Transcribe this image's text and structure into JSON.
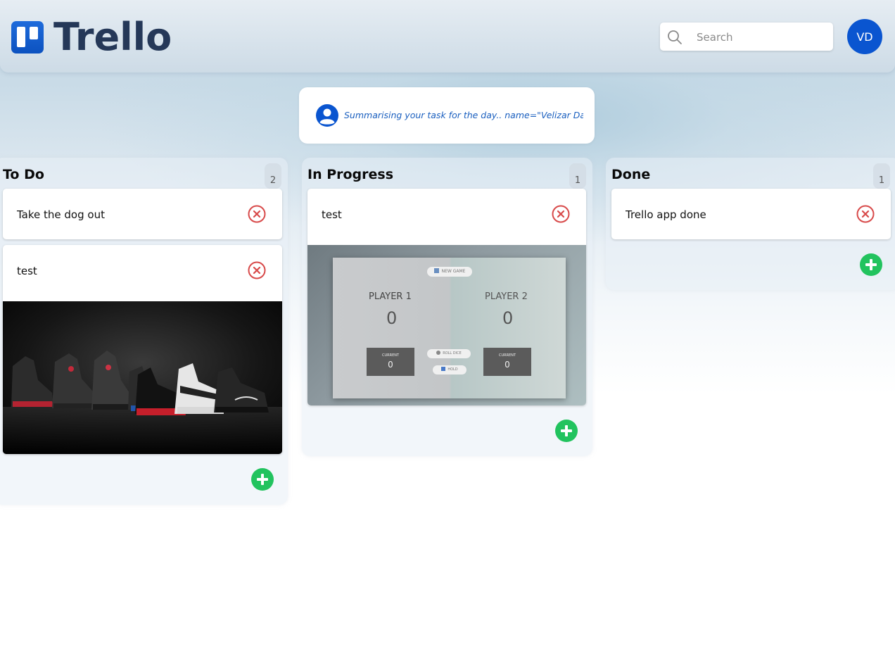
{
  "header": {
    "logo_text": "Trello",
    "search_placeholder": "Search",
    "avatar_initials": "VD"
  },
  "summary": {
    "text": "Summarising your task for the day.. name=\"Velizar Dabov"
  },
  "columns": [
    {
      "title": "To Do",
      "count": "2",
      "cards": [
        {
          "text": "Take the dog out",
          "has_image": false
        },
        {
          "text": "test",
          "has_image": true,
          "image": "sneakers-photo"
        }
      ]
    },
    {
      "title": "In Progress",
      "count": "1",
      "cards": [
        {
          "text": "test",
          "has_image": true,
          "image": "dice-game-screenshot"
        }
      ]
    },
    {
      "title": "Done",
      "count": "1",
      "cards": [
        {
          "text": "Trello app done",
          "has_image": false
        }
      ]
    }
  ],
  "dice_game": {
    "new_game_label": "NEW GAME",
    "player1_label": "PLAYER 1",
    "player2_label": "PLAYER 2",
    "player1_score": "0",
    "player2_score": "0",
    "current_label": "CURRENT",
    "player1_current": "0",
    "player2_current": "0",
    "roll_dice_label": "ROLL DICE",
    "hold_label": "HOLD"
  },
  "colors": {
    "brand_blue": "#0a55d0",
    "logo_text": "#253858",
    "add_green": "#22c35e",
    "delete_red": "#d84a4a"
  }
}
